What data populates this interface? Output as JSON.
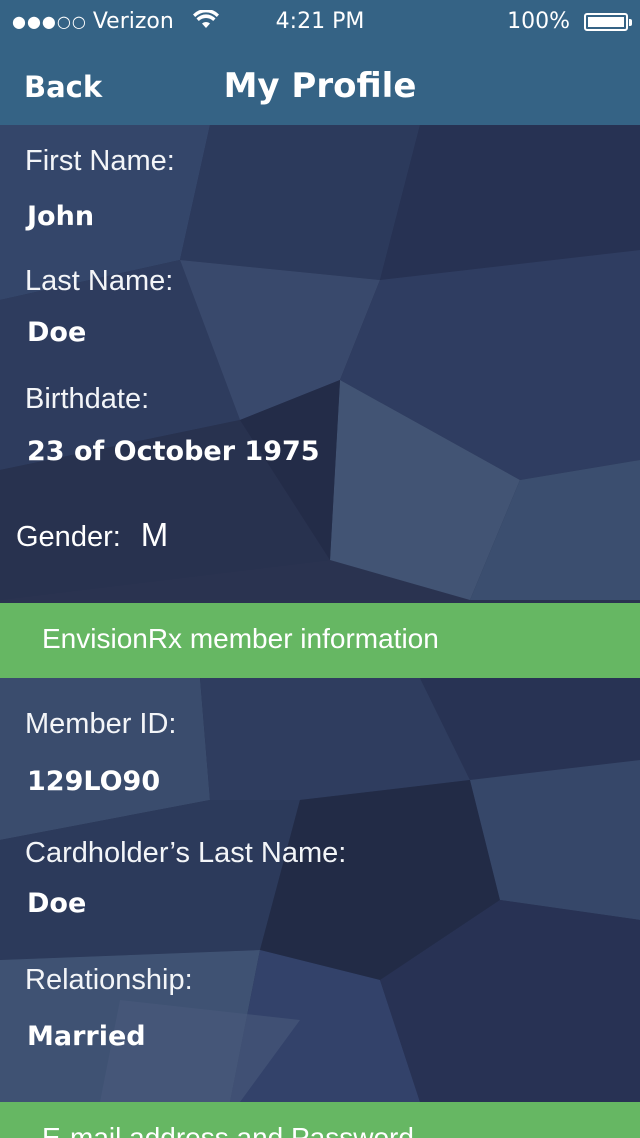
{
  "status_bar": {
    "signal": "●●●○○",
    "carrier": "Verizon",
    "time": "4:21 PM",
    "battery_percent": "100%",
    "battery_level": 1.0,
    "wifi_icon": "wifi-icon"
  },
  "nav": {
    "back_label": "Back",
    "title": "My Profile"
  },
  "profile": {
    "first_name_label": "First Name:",
    "first_name": "John",
    "last_name_label": "Last Name:",
    "last_name": "Doe",
    "birthdate_label": "Birthdate:",
    "birthdate": "23 of October 1975",
    "gender_label": "Gender:",
    "gender": "M"
  },
  "member_section": {
    "title": "EnvisionRx member information",
    "member_id_label": "Member ID:",
    "member_id": "129LO90",
    "cardholder_label": "Cardholder’s Last Name:",
    "cardholder": "Doe",
    "relationship_label": "Relationship:",
    "relationship": "Married"
  },
  "email_section": {
    "title": "E-mail address and Password"
  },
  "colors": {
    "header": "#356385",
    "section_band": "#66b763",
    "background": "#2a3350"
  }
}
